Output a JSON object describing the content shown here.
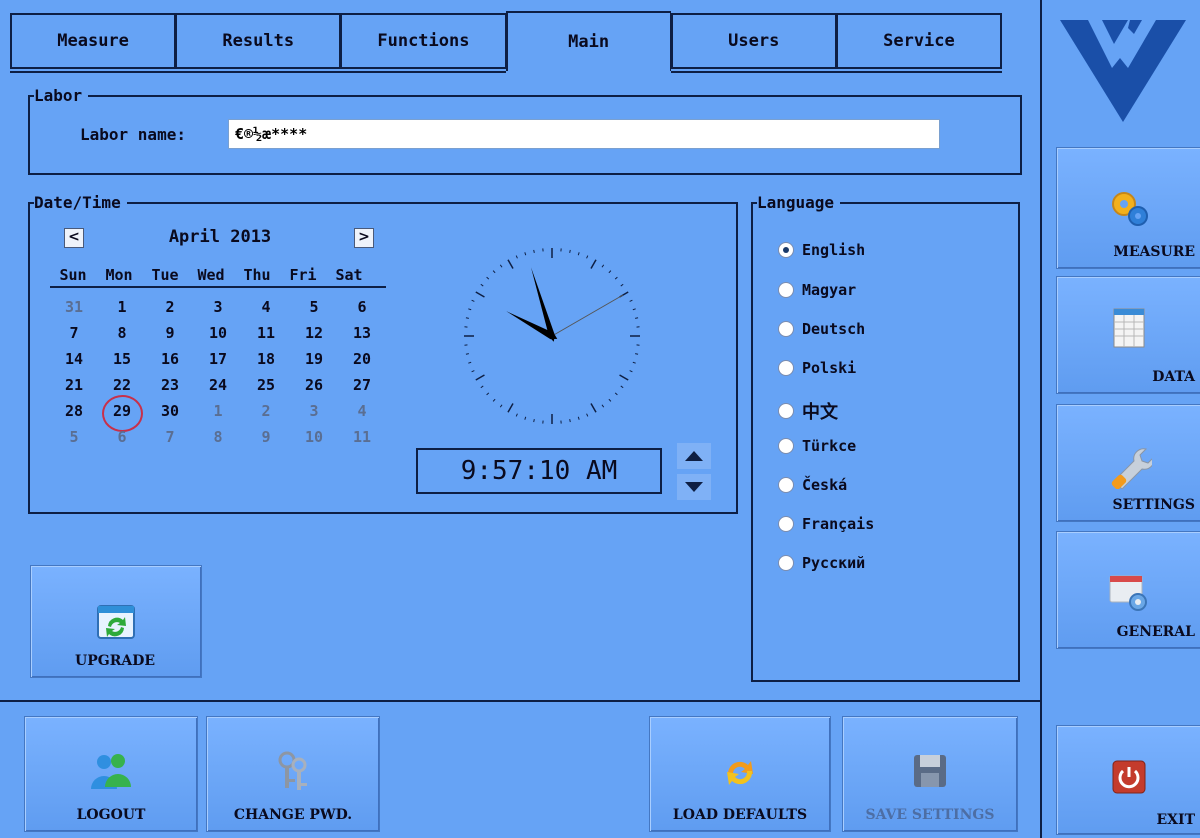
{
  "tabs": [
    "Measure",
    "Results",
    "Functions",
    "Main",
    "Users",
    "Service"
  ],
  "labor": {
    "legend": "Labor",
    "name_label": "Labor name:",
    "name_value": "€®½æ****"
  },
  "datetime": {
    "legend": "Date/Time",
    "month_year": "April 2013",
    "prev": "<",
    "next": ">",
    "weekdays": [
      "Sun",
      "Mon",
      "Tue",
      "Wed",
      "Thu",
      "Fri",
      "Sat"
    ],
    "weeks": [
      [
        "31",
        "1",
        "2",
        "3",
        "4",
        "5",
        "6"
      ],
      [
        "7",
        "8",
        "9",
        "10",
        "11",
        "12",
        "13"
      ],
      [
        "14",
        "15",
        "16",
        "17",
        "18",
        "19",
        "20"
      ],
      [
        "21",
        "22",
        "23",
        "24",
        "25",
        "26",
        "27"
      ],
      [
        "28",
        "29",
        "30",
        "1",
        "2",
        "3",
        "4"
      ],
      [
        "5",
        "6",
        "7",
        "8",
        "9",
        "10",
        "11"
      ]
    ],
    "selected_day": "29",
    "time": "9:57:10 AM",
    "clock": {
      "hours": 9,
      "minutes": 57,
      "seconds": 10
    }
  },
  "language": {
    "legend": "Language",
    "options": [
      "English",
      "Magyar",
      "Deutsch",
      "Polski",
      "中文",
      "Türkce",
      "Česká",
      "Français",
      "Русский"
    ],
    "selected": "English"
  },
  "buttons": {
    "upgrade": "UPGRADE",
    "logout": "LOGOUT",
    "change_pwd": "CHANGE PWD.",
    "load_defaults": "LOAD DEFAULTS",
    "save_settings": "SAVE SETTINGS"
  },
  "side": {
    "measure": "MEASURE",
    "data": "DATA",
    "settings": "SETTINGS",
    "general": "GENERAL",
    "exit": "EXIT"
  },
  "colors": {
    "background": "#66a3f5",
    "border": "#0e1f44",
    "logo": "#1a4fa8",
    "today_circle": "#c8304a"
  }
}
